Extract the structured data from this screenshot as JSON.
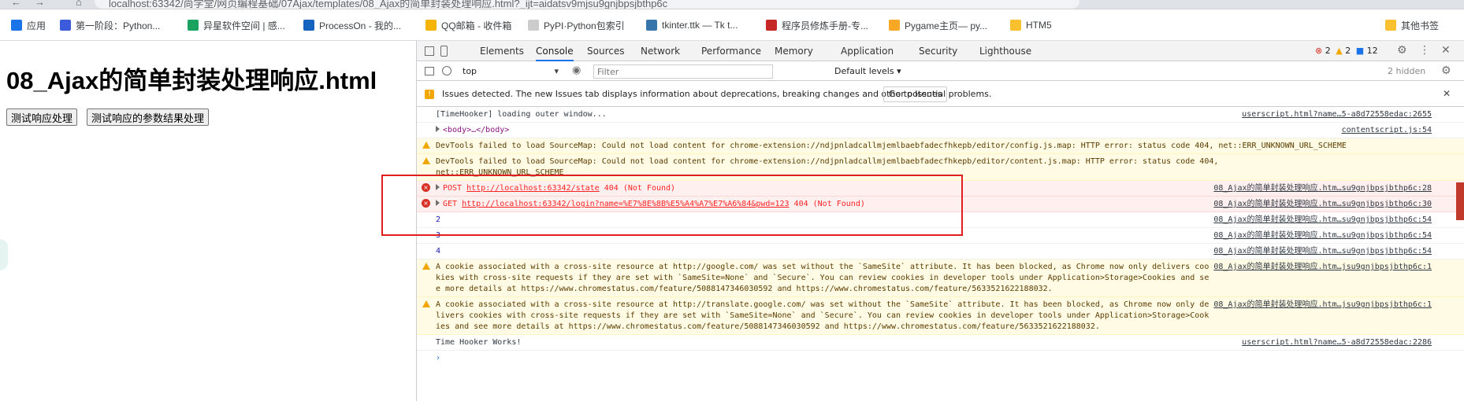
{
  "browser": {
    "url": "localhost:63342/尚学堂/网页编程基础/07Ajax/templates/08_Ajax的简单封装处理响应.html?_ijt=aidatsv9mjsu9gnjbpsjbthp6c",
    "nav_back": "←",
    "nav_forward": "→",
    "nav_home": "⌂"
  },
  "bookmarks": [
    {
      "label": "应用",
      "color": "#1a73e8"
    },
    {
      "label": "第一阶段：Python...",
      "color": "#3b5bdb"
    },
    {
      "label": "异星软件空间 | 感...",
      "color": "#1aa260"
    },
    {
      "label": "ProcessOn - 我的...",
      "color": "#1565c0"
    },
    {
      "label": "QQ邮箱 - 收件箱",
      "color": "#f4b400"
    },
    {
      "label": "PyPI·Python包索引",
      "color": "#cccccc"
    },
    {
      "label": "tkinter.ttk — Tk t...",
      "color": "#3776ab"
    },
    {
      "label": "程序员修炼手册-专...",
      "color": "#c62828"
    },
    {
      "label": "Pygame主页— py...",
      "color": "#f9a825"
    },
    {
      "label": "HTM5",
      "color": "#fbc02d"
    },
    {
      "label": "其他书签",
      "color": "#fbc02d"
    }
  ],
  "page": {
    "title": "08_Ajax的简单封装处理响应.html",
    "buttons": [
      "测试响应处理",
      "测试响应的参数结果处理"
    ]
  },
  "devtools": {
    "tabs": [
      "Elements",
      "Console",
      "Sources",
      "Network",
      "Performance",
      "Memory",
      "Application",
      "Security",
      "Lighthouse"
    ],
    "active_tab": "Console",
    "counts": {
      "errors": "2",
      "warnings": "2",
      "info": "12"
    },
    "context": "top",
    "filter_placeholder": "Filter",
    "levels": "Default levels ▾",
    "hidden": "2 hidden",
    "issues_text": "Issues detected. The new Issues tab displays information about deprecations, breaking changes and other potential problems.",
    "issues_button": "Go to Issues",
    "messages": [
      {
        "type": "log",
        "text": "[TimeHooker] loading outer window...",
        "source": "userscript.html?name…5-a8d72558edac:2655"
      },
      {
        "type": "log",
        "text": "<body>…</body>",
        "source": "contentscript.js:54"
      },
      {
        "type": "warn",
        "text": "DevTools failed to load SourceMap: Could not load content for chrome-extension://ndjpnladcallmjemlbaebfadecfhkepb/editor/config.js.map: HTTP error: status code 404, net::ERR_UNKNOWN_URL_SCHEME",
        "source": ""
      },
      {
        "type": "warn",
        "text": "DevTools failed to load SourceMap: Could not load content for chrome-extension://ndjpnladcallmjemlbaebfadecfhkepb/editor/content.js.map: HTTP error: status code 404,\nnet::ERR_UNKNOWN_URL_SCHEME",
        "source": ""
      },
      {
        "type": "error",
        "method": "POST",
        "url": "http://localhost:63342/state",
        "status": "404 (Not Found)",
        "source": "08_Ajax的简单封装处理响应.htm…su9gnjbpsjbthp6c:28"
      },
      {
        "type": "error",
        "method": "GET",
        "url": "http://localhost:63342/login?name=%E7%8E%8B%E5%A4%A7%E7%A6%84&pwd=123",
        "status": "404 (Not Found)",
        "source": "08_Ajax的简单封装处理响应.htm…su9gnjbpsjbthp6c:30"
      },
      {
        "type": "num",
        "text": "2",
        "source": "08_Ajax的简单封装处理响应.htm…su9gnjbpsjbthp6c:54"
      },
      {
        "type": "num",
        "text": "3",
        "source": "08_Ajax的简单封装处理响应.htm…su9gnjbpsjbthp6c:54"
      },
      {
        "type": "num",
        "text": "4",
        "source": "08_Ajax的简单封装处理响应.htm…su9gnjbpsjbthp6c:54"
      },
      {
        "type": "warn",
        "text": "A cookie associated with a cross-site resource at http://google.com/ was set without the `SameSite` attribute. It has been blocked, as Chrome now only delivers cookies with cross-site requests if they are set with `SameSite=None` and `Secure`. You can review cookies in developer tools under Application>Storage>Cookies and see more details at https://www.chromestatus.com/feature/5088147346030592 and https://www.chromestatus.com/feature/5633521622188032.",
        "source": "08_Ajax的简单封装处理响应.htm…jsu9gnjbpsjbthp6c:1"
      },
      {
        "type": "warn",
        "text": "A cookie associated with a cross-site resource at http://translate.google.com/ was set without the `SameSite` attribute. It has been blocked, as Chrome now only delivers cookies with cross-site requests if they are set with `SameSite=None` and `Secure`. You can review cookies in developer tools under Application>Storage>Cookies and see more details at https://www.chromestatus.com/feature/5088147346030592 and https://www.chromestatus.com/feature/5633521622188032.",
        "source": "08_Ajax的简单封装处理响应.htm…jsu9gnjbpsjbthp6c:1"
      },
      {
        "type": "log",
        "text": "Time Hooker Works!",
        "source": "userscript.html?name…5-a8d72558edac:2286"
      }
    ],
    "prompt": "›"
  }
}
